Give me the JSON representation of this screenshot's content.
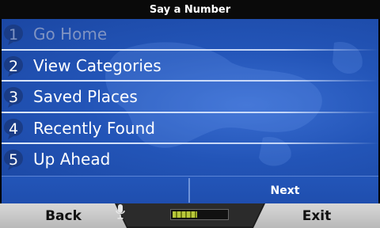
{
  "title": "Say a Number",
  "menu": {
    "items": [
      {
        "number": "1",
        "label": "Go Home",
        "disabled": true
      },
      {
        "number": "2",
        "label": "View Categories",
        "disabled": false
      },
      {
        "number": "3",
        "label": "Saved Places",
        "disabled": false
      },
      {
        "number": "4",
        "label": "Recently Found",
        "disabled": false
      },
      {
        "number": "5",
        "label": "Up Ahead",
        "disabled": false
      }
    ]
  },
  "next_label": "Next",
  "footer": {
    "back_label": "Back",
    "exit_label": "Exit",
    "mic_icon": "microphone-icon",
    "mic_level": 0.45
  },
  "colors": {
    "panel_blue": "#2355b8",
    "disabled_text": "#7f93c2",
    "title_bg": "#0a0a0a",
    "footer_gray": "#c8c8c8",
    "meter_green": "#b8c83a"
  }
}
